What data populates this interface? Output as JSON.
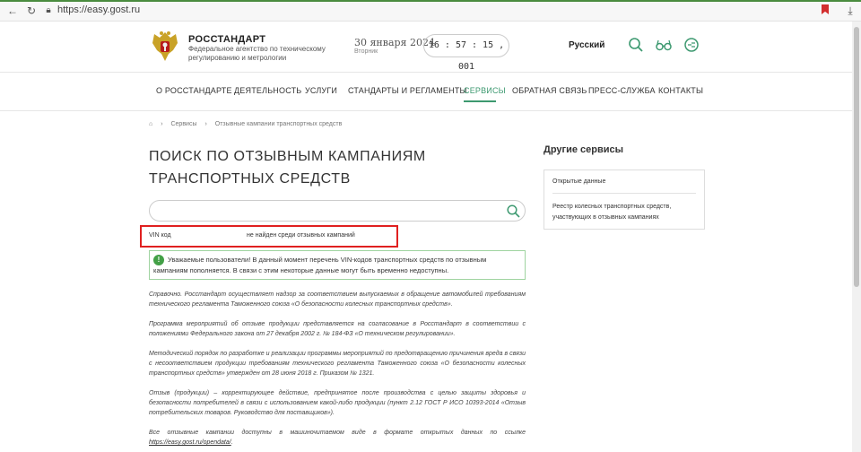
{
  "browser": {
    "url": "https://easy.gost.ru"
  },
  "header": {
    "org_name": "РОССТАНДАРТ",
    "org_subtitle": "Федеральное агентство по техническому регулированию и метрологии",
    "date": "30 января 2024",
    "weekday": "Вторник",
    "clock": "16 : 57 : 15 , 001",
    "language": "Русский",
    "icons": [
      "search-icon",
      "glasses-icon",
      "sign-language-icon"
    ]
  },
  "nav": {
    "items": [
      {
        "label": "О РОССТАНДАРТЕ",
        "active": false
      },
      {
        "label": "ДЕЯТЕЛЬНОСТЬ",
        "active": false
      },
      {
        "label": "УСЛУГИ",
        "active": false
      },
      {
        "label": "СТАНДАРТЫ И РЕГЛАМЕНТЫ",
        "active": false
      },
      {
        "label": "СЕРВИСЫ",
        "active": true
      },
      {
        "label": "ОБРАТНАЯ СВЯЗЬ",
        "active": false
      },
      {
        "label": "ПРЕСС-СЛУЖБА",
        "active": false
      },
      {
        "label": "КОНТАКТЫ",
        "active": false
      }
    ],
    "accent_color": "#3d9970"
  },
  "breadcrumb": {
    "items": [
      "Сервисы",
      "Отзывные кампании транспортных средств"
    ]
  },
  "main": {
    "title": "ПОИСК ПО ОТЗЫВНЫМ КАМПАНИЯМ ТРАНСПОРТНЫХ СРЕДСТВ",
    "search_value": "",
    "result_prefix": "VIN код",
    "result_text": "не найден среди отзывных кампаний",
    "notice": "Уважаемые пользователи! В данный момент перечень VIN-кодов транспортных средств по отзывным кампаниям пополняется. В связи с этим некоторые данные могут быть временно недоступны.",
    "paragraphs": [
      "Справочно. Росстандарт осуществляет надзор за соответствием выпускаемых в обращение автомобилей требованиям технического регламента Таможенного союза «О безопасности колесных транспортных средств».",
      "Программа мероприятий об отзыве продукции представляется на согласование в Росстандарт в соответствии с положениями Федерального закона от 27 декабря 2002 г. № 184-ФЗ «О техническом регулировании».",
      "Методический порядок по разработке и реализации программы мероприятий по предотвращению причинения вреда в связи с несоответствием продукции требованиям технического регламента Таможенного союза «О безопасности колесных транспортных средств» утвержден от 28 июня 2018 г. Приказом № 1321.",
      "Отзыв (продукции) – корректирующее действие, предпринятое после производства с целью защиты здоровья и безопасности потребителей в связи с использованием какой-либо продукции (пункт 2.12 ГОСТ Р ИСО 10393-2014 «Отзыв потребительских товаров. Руководство для поставщиков»)."
    ],
    "last_paragraph_text": "Все отзывные кампании доступны в машиночитаемом виде в формате открытых данных по ссылке",
    "last_paragraph_link": "https://easy.gost.ru/opendata/",
    "last_paragraph_end": "."
  },
  "sidebar": {
    "title": "Другие сервисы",
    "links": [
      "Открытые данные",
      "Реестр колесных транспортных средств, участвующих в отзывных кампаниях"
    ]
  }
}
